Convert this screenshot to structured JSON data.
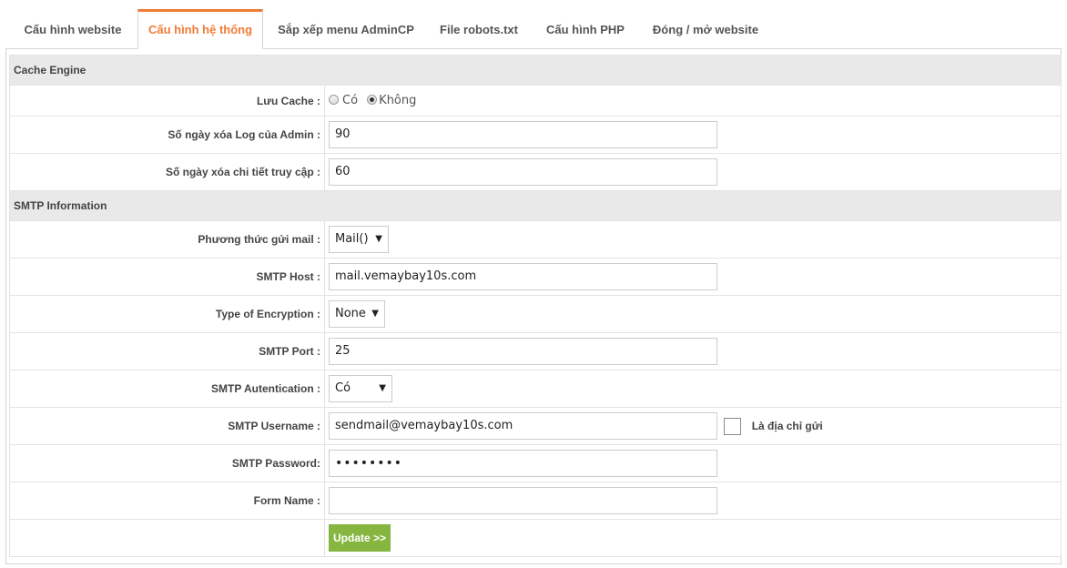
{
  "tabs": [
    {
      "label": "Cấu hình website"
    },
    {
      "label": "Cấu hình hệ thống"
    },
    {
      "label": "Sắp xếp menu AdminCP"
    },
    {
      "label": "File robots.txt"
    },
    {
      "label": "Cấu hình PHP"
    },
    {
      "label": "Đóng / mở website"
    }
  ],
  "active_tab": "Cấu hình hệ thống",
  "accent_color": "#f07b36",
  "button_color": "#86b640",
  "cache_section": {
    "title": "Cache Engine",
    "luu_cache": {
      "label": "Lưu Cache :",
      "options": [
        "Có",
        "Không"
      ],
      "selected": "Không"
    },
    "log_admin": {
      "label": "Số ngày xóa Log của Admin :",
      "value": "90"
    },
    "access_detail": {
      "label": "Số ngày xóa chi tiết truy cập :",
      "value": "60"
    }
  },
  "smtp_section": {
    "title": "SMTP Information",
    "mail_method": {
      "label": "Phương thức gửi mail :",
      "value": "Mail()"
    },
    "host": {
      "label": "SMTP Host :",
      "value": "mail.vemaybay10s.com"
    },
    "encryption": {
      "label": "Type of Encryption :",
      "value": "None"
    },
    "port": {
      "label": "SMTP Port :",
      "value": "25"
    },
    "auth": {
      "label": "SMTP Autentication :",
      "value": "Có"
    },
    "username": {
      "label": "SMTP Username :",
      "value": "sendmail@vemaybay10s.com",
      "checkbox_label": "Là địa chỉ gửi",
      "checkbox_checked": false
    },
    "password": {
      "label": "SMTP Password:",
      "value": "••••••••"
    },
    "form_name": {
      "label": "Form Name :",
      "value": ""
    }
  },
  "submit": {
    "label": "Update >>"
  }
}
